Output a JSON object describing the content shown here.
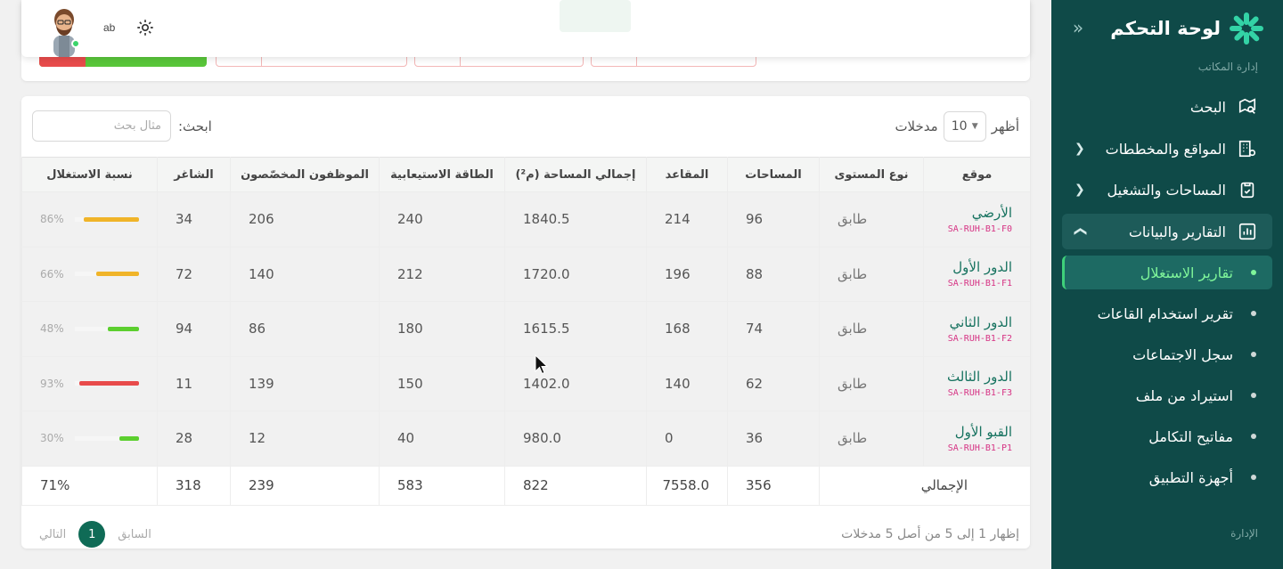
{
  "brand": {
    "title": "لوحة التحكم"
  },
  "sidebar": {
    "section_office": "إدارة المكاتب",
    "section_admin": "الإدارة",
    "items": [
      {
        "label": "البحث",
        "icon": "map-search-icon"
      },
      {
        "label": "المواقع والمخططات",
        "icon": "building-settings-icon"
      },
      {
        "label": "المساحات والتشغيل",
        "icon": "clipboard-check-icon"
      },
      {
        "label": "التقارير والبيانات",
        "icon": "chart-icon"
      }
    ],
    "sub_items": [
      {
        "label": "تقارير الاستغلال",
        "active": true
      },
      {
        "label": "تقرير استخدام القاعات"
      },
      {
        "label": "سجل الاجتماعات"
      },
      {
        "label": "استيراد من ملف"
      },
      {
        "label": "مفاتيح التكامل"
      },
      {
        "label": "أجهزة التطبيق"
      }
    ]
  },
  "header": {
    "lang": "ab"
  },
  "table_controls": {
    "show_label": "أظهر",
    "entries_label": "مدخلات",
    "page_length": "10",
    "search_label": "ابحث:",
    "search_placeholder": "مثال بحث"
  },
  "table": {
    "headers": [
      "موقع",
      "نوع المستوى",
      "المساحات",
      "المقاعد",
      "إجمالي المساحة (م²)",
      "الطاقة الاستيعابية",
      "الموظفون المخصّصون",
      "الشاغر",
      "نسبة الاستغلال"
    ],
    "rows": [
      {
        "name": "الأرضي",
        "code": "SA-RUH-B1-F0",
        "type": "طابق",
        "spaces": "96",
        "seats": "214",
        "area": "1840.5",
        "capacity": "240",
        "assigned": "206",
        "vacant": "34",
        "util": "86%",
        "util_value": 0.86,
        "util_color": "#f0b429"
      },
      {
        "name": "الدور الأول",
        "code": "SA-RUH-B1-F1",
        "type": "طابق",
        "spaces": "88",
        "seats": "196",
        "area": "1720.0",
        "capacity": "212",
        "assigned": "140",
        "vacant": "72",
        "util": "66%",
        "util_value": 0.66,
        "util_color": "#f0b429"
      },
      {
        "name": "الدور الثاني",
        "code": "SA-RUH-B1-F2",
        "type": "طابق",
        "spaces": "74",
        "seats": "168",
        "area": "1615.5",
        "capacity": "180",
        "assigned": "86",
        "vacant": "94",
        "util": "48%",
        "util_value": 0.48,
        "util_color": "#5ccf2f"
      },
      {
        "name": "الدور الثالث",
        "code": "SA-RUH-B1-F3",
        "type": "طابق",
        "spaces": "62",
        "seats": "140",
        "area": "1402.0",
        "capacity": "150",
        "assigned": "139",
        "vacant": "11",
        "util": "93%",
        "util_value": 0.93,
        "util_color": "#e84b4b"
      },
      {
        "name": "القبو الأول",
        "code": "SA-RUH-B1-P1",
        "type": "طابق",
        "spaces": "36",
        "seats": "0",
        "area": "980.0",
        "capacity": "40",
        "assigned": "12",
        "vacant": "28",
        "util": "30%",
        "util_value": 0.3,
        "util_color": "#5ccf2f"
      }
    ],
    "total": {
      "label": "الإجمالي",
      "spaces": "356",
      "seats": "7558.0",
      "area": "822",
      "capacity": "583",
      "assigned": "239",
      "vacant": "318",
      "util": "71%"
    }
  },
  "footer": {
    "info": "إظهار 1 إلى 5 من أصل 5 مدخلات",
    "prev": "السابق",
    "next": "التالي",
    "page": "1"
  }
}
